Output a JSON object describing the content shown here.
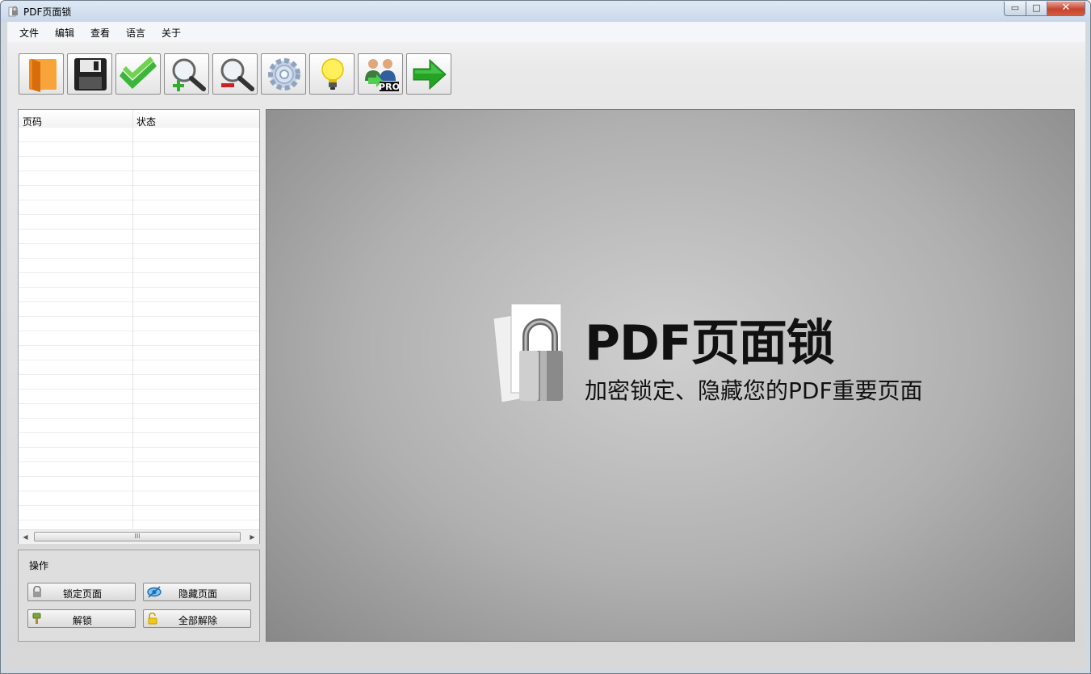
{
  "window": {
    "title": "PDF页面锁",
    "buttons": {
      "minimize": "▭",
      "maximize": "□",
      "close": "✕"
    }
  },
  "menubar": {
    "items": [
      "文件",
      "编辑",
      "查看",
      "语言",
      "关于"
    ]
  },
  "toolbar": {
    "buttons": [
      {
        "name": "open-folder-icon"
      },
      {
        "name": "save-icon"
      },
      {
        "name": "checkmark-icon"
      },
      {
        "name": "zoom-in-icon"
      },
      {
        "name": "zoom-out-icon"
      },
      {
        "name": "gear-icon"
      },
      {
        "name": "lightbulb-icon"
      },
      {
        "name": "pro-users-icon",
        "badge": "PRO"
      },
      {
        "name": "arrow-right-icon"
      }
    ]
  },
  "page_list": {
    "columns": [
      "页码",
      "状态"
    ],
    "scroll_grip": "III"
  },
  "operations": {
    "title": "操作",
    "lock_label": "锁定页面",
    "hide_label": "隐藏页面",
    "unlock_label": "解锁",
    "unlock_all_label": "全部解除"
  },
  "preview": {
    "logo_title": "PDF页面锁",
    "logo_subtitle": "加密锁定、隐藏您的PDF重要页面"
  },
  "colors": {
    "title_bar": "#c8d8ea",
    "close_button": "#c7442d",
    "check_green": "#3bb63b",
    "arrow_green": "#25a325"
  }
}
